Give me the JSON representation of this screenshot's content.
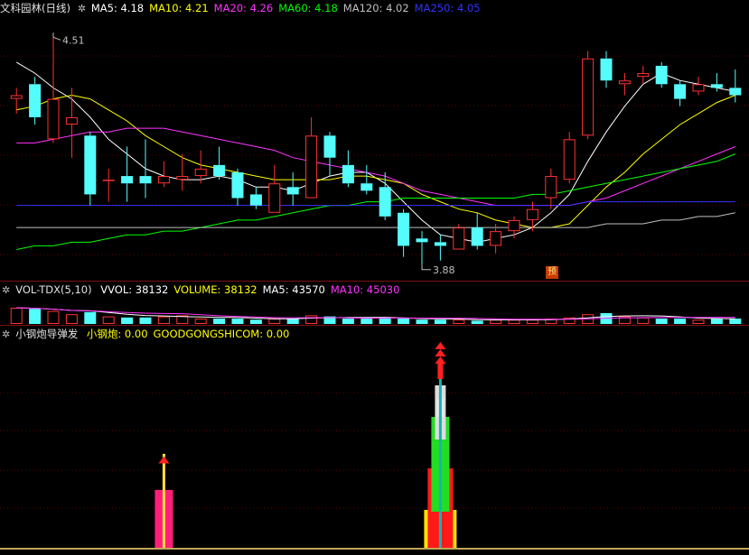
{
  "price_panel": {
    "stock_name": "文科园林",
    "period": "(日线)",
    "ma_labels": [
      {
        "text": "MA5: 4.18",
        "color": "#ffffff"
      },
      {
        "text": "MA10: 4.21",
        "color": "#ffff00"
      },
      {
        "text": "MA20: 4.26",
        "color": "#ff33ff"
      },
      {
        "text": "MA60: 4.18",
        "color": "#00ff00"
      },
      {
        "text": "MA120: 4.02",
        "color": "#c0c0c0"
      },
      {
        "text": "MA250: 4.05",
        "color": "#3333ff"
      }
    ],
    "high_marker": "4.51",
    "low_marker": "3.88",
    "forecast_badge": "预",
    "colors": {
      "up": "#ff3232",
      "down": "#54fcfc"
    }
  },
  "volume_panel": {
    "title": "VOL-TDX(5,10)",
    "labels": [
      {
        "text": "VVOL: 38132",
        "color": "#ffffff"
      },
      {
        "text": "VOLUME: 38132",
        "color": "#ffff00"
      },
      {
        "text": "MA5: 43570",
        "color": "#ffffff"
      },
      {
        "text": "MA10: 45030",
        "color": "#ff33ff"
      }
    ]
  },
  "indicator_panel": {
    "title": "小钢炮导弹发",
    "labels": [
      {
        "text": "小钢炮: 0.00",
        "color": "#ffff00"
      },
      {
        "text": "GOODGONGSHICOM: 0.00",
        "color": "#ffff00"
      }
    ]
  },
  "chart_data": {
    "type": "candlestick",
    "y_range": [
      3.85,
      4.55
    ],
    "candles": [
      {
        "o": 4.33,
        "c": 4.34,
        "h": 4.36,
        "l": 4.29
      },
      {
        "o": 4.37,
        "c": 4.28,
        "h": 4.39,
        "l": 4.26
      },
      {
        "o": 4.22,
        "c": 4.33,
        "h": 4.51,
        "l": 4.21
      },
      {
        "o": 4.26,
        "c": 4.28,
        "h": 4.36,
        "l": 4.17
      },
      {
        "o": 4.23,
        "c": 4.07,
        "h": 4.24,
        "l": 4.04
      },
      {
        "o": 4.11,
        "c": 4.11,
        "h": 4.14,
        "l": 4.05
      },
      {
        "o": 4.12,
        "c": 4.1,
        "h": 4.2,
        "l": 4.05
      },
      {
        "o": 4.12,
        "c": 4.1,
        "h": 4.22,
        "l": 4.06
      },
      {
        "o": 4.1,
        "c": 4.12,
        "h": 4.16,
        "l": 4.09
      },
      {
        "o": 4.11,
        "c": 4.12,
        "h": 4.18,
        "l": 4.08
      },
      {
        "o": 4.12,
        "c": 4.14,
        "h": 4.19,
        "l": 4.1
      },
      {
        "o": 4.15,
        "c": 4.12,
        "h": 4.2,
        "l": 4.11
      },
      {
        "o": 4.13,
        "c": 4.06,
        "h": 4.14,
        "l": 4.04
      },
      {
        "o": 4.07,
        "c": 4.04,
        "h": 4.09,
        "l": 4.03
      },
      {
        "o": 4.02,
        "c": 4.1,
        "h": 4.15,
        "l": 4.02
      },
      {
        "o": 4.09,
        "c": 4.07,
        "h": 4.13,
        "l": 4.04
      },
      {
        "o": 4.06,
        "c": 4.23,
        "h": 4.28,
        "l": 4.06
      },
      {
        "o": 4.23,
        "c": 4.17,
        "h": 4.24,
        "l": 4.12
      },
      {
        "o": 4.15,
        "c": 4.1,
        "h": 4.19,
        "l": 4.09
      },
      {
        "o": 4.1,
        "c": 4.08,
        "h": 4.15,
        "l": 4.07
      },
      {
        "o": 4.09,
        "c": 4.01,
        "h": 4.13,
        "l": 4.0
      },
      {
        "o": 4.02,
        "c": 3.93,
        "h": 4.03,
        "l": 3.9
      },
      {
        "o": 3.95,
        "c": 3.94,
        "h": 3.97,
        "l": 3.88
      },
      {
        "o": 3.94,
        "c": 3.93,
        "h": 3.96,
        "l": 3.89
      },
      {
        "o": 3.92,
        "c": 3.98,
        "h": 3.99,
        "l": 3.92
      },
      {
        "o": 3.98,
        "c": 3.93,
        "h": 4.02,
        "l": 3.92
      },
      {
        "o": 3.93,
        "c": 3.97,
        "h": 3.99,
        "l": 3.91
      },
      {
        "o": 3.97,
        "c": 4.0,
        "h": 4.01,
        "l": 3.95
      },
      {
        "o": 4.0,
        "c": 4.03,
        "h": 4.05,
        "l": 3.97
      },
      {
        "o": 4.06,
        "c": 4.12,
        "h": 4.14,
        "l": 4.03
      },
      {
        "o": 4.11,
        "c": 4.22,
        "h": 4.24,
        "l": 4.1
      },
      {
        "o": 4.23,
        "c": 4.44,
        "h": 4.46,
        "l": 4.22
      },
      {
        "o": 4.44,
        "c": 4.38,
        "h": 4.46,
        "l": 4.36
      },
      {
        "o": 4.37,
        "c": 4.38,
        "h": 4.4,
        "l": 4.34
      },
      {
        "o": 4.39,
        "c": 4.4,
        "h": 4.42,
        "l": 4.37
      },
      {
        "o": 4.42,
        "c": 4.37,
        "h": 4.43,
        "l": 4.36
      },
      {
        "o": 4.37,
        "c": 4.33,
        "h": 4.38,
        "l": 4.31
      },
      {
        "o": 4.35,
        "c": 4.37,
        "h": 4.39,
        "l": 4.34
      },
      {
        "o": 4.37,
        "c": 4.36,
        "h": 4.4,
        "l": 4.35
      },
      {
        "o": 4.36,
        "c": 4.34,
        "h": 4.41,
        "l": 4.32
      }
    ],
    "ma_lines": [
      {
        "name": "MA5",
        "color": "#ffffff",
        "values": [
          4.43,
          4.4,
          4.36,
          4.33,
          4.28,
          4.22,
          4.18,
          4.14,
          4.12,
          4.11,
          4.11,
          4.12,
          4.11,
          4.09,
          4.09,
          4.08,
          4.1,
          4.12,
          4.13,
          4.13,
          4.1,
          4.05,
          4.0,
          3.96,
          3.95,
          3.94,
          3.95,
          3.96,
          3.98,
          4.02,
          4.07,
          4.16,
          4.24,
          4.31,
          4.37,
          4.4,
          4.38,
          4.37,
          4.36,
          4.35
        ]
      },
      {
        "name": "MA10",
        "color": "#ffff00",
        "values": [
          4.3,
          4.31,
          4.33,
          4.34,
          4.33,
          4.3,
          4.27,
          4.23,
          4.2,
          4.17,
          4.15,
          4.14,
          4.13,
          4.12,
          4.11,
          4.11,
          4.11,
          4.11,
          4.12,
          4.12,
          4.11,
          4.1,
          4.07,
          4.05,
          4.03,
          4.02,
          4.0,
          3.99,
          3.98,
          3.98,
          3.99,
          4.04,
          4.09,
          4.13,
          4.18,
          4.22,
          4.26,
          4.29,
          4.32,
          4.34
        ]
      },
      {
        "name": "MA20",
        "color": "#ff33ff",
        "values": [
          4.21,
          4.21,
          4.22,
          4.23,
          4.24,
          4.24,
          4.25,
          4.25,
          4.25,
          4.24,
          4.23,
          4.22,
          4.21,
          4.2,
          4.19,
          4.17,
          4.16,
          4.15,
          4.14,
          4.13,
          4.12,
          4.1,
          4.08,
          4.07,
          4.06,
          4.05,
          4.04,
          4.04,
          4.04,
          4.04,
          4.04,
          4.05,
          4.06,
          4.08,
          4.1,
          4.12,
          4.14,
          4.16,
          4.18,
          4.2
        ]
      },
      {
        "name": "MA60",
        "color": "#00ff00",
        "values": [
          3.92,
          3.93,
          3.93,
          3.94,
          3.94,
          3.95,
          3.96,
          3.96,
          3.97,
          3.97,
          3.98,
          3.99,
          4.0,
          4.0,
          4.01,
          4.02,
          4.03,
          4.04,
          4.04,
          4.05,
          4.05,
          4.06,
          4.06,
          4.06,
          4.06,
          4.06,
          4.06,
          4.06,
          4.07,
          4.07,
          4.08,
          4.09,
          4.1,
          4.11,
          4.12,
          4.13,
          4.14,
          4.15,
          4.16,
          4.18
        ]
      },
      {
        "name": "MA120",
        "color": "#c0c0c0",
        "values": [
          3.98,
          3.98,
          3.98,
          3.98,
          3.98,
          3.98,
          3.98,
          3.98,
          3.98,
          3.98,
          3.98,
          3.98,
          3.98,
          3.98,
          3.98,
          3.98,
          3.98,
          3.98,
          3.98,
          3.98,
          3.98,
          3.98,
          3.98,
          3.98,
          3.98,
          3.98,
          3.98,
          3.98,
          3.98,
          3.98,
          3.98,
          3.98,
          3.99,
          3.99,
          3.99,
          4.0,
          4.0,
          4.01,
          4.01,
          4.02
        ]
      },
      {
        "name": "MA250",
        "color": "#3333ff",
        "values": [
          4.04,
          4.04,
          4.04,
          4.04,
          4.04,
          4.04,
          4.04,
          4.04,
          4.04,
          4.04,
          4.04,
          4.04,
          4.04,
          4.04,
          4.04,
          4.04,
          4.04,
          4.04,
          4.04,
          4.04,
          4.04,
          4.04,
          4.04,
          4.04,
          4.04,
          4.04,
          4.04,
          4.04,
          4.04,
          4.04,
          4.04,
          4.05,
          4.05,
          4.05,
          4.05,
          4.05,
          4.05,
          4.05,
          4.05,
          4.05
        ]
      }
    ],
    "volumes": [
      15,
      14,
      12,
      9,
      11,
      7,
      6,
      6,
      7,
      8,
      5,
      5,
      5,
      4,
      5,
      5,
      8,
      7,
      5,
      5,
      6,
      5,
      4,
      4,
      4,
      3,
      4,
      4,
      4,
      5,
      6,
      9,
      10,
      7,
      6,
      5,
      5,
      4,
      5,
      5
    ],
    "signals": [
      {
        "index": 8,
        "level": 0.3
      },
      {
        "index": 23,
        "level": 1.0
      }
    ]
  }
}
